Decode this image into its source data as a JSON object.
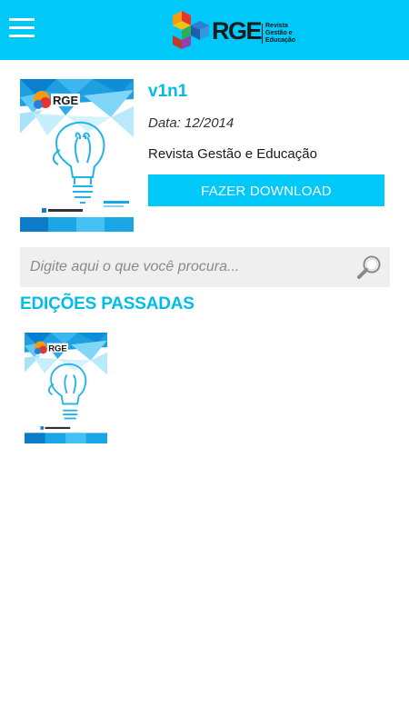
{
  "header": {
    "logo_text": "RGE",
    "logo_subtitle": "Revista Gestão e Educação",
    "background_color": "#00c8f8"
  },
  "current_issue": {
    "title": "v1n1",
    "date": "Data: 12/2014",
    "journal": "Revista Gestão e Educação",
    "download_label": "FAZER DOWNLOAD",
    "cover_image": "magazine-cover-lightbulb"
  },
  "search": {
    "placeholder": "Digite aqui o que você procura...",
    "value": "",
    "icon": "magnifier-icon"
  },
  "past_editions": {
    "title": "EDIÇÕES PASSADAS",
    "items": [
      {
        "cover_image": "magazine-cover-lightbulb"
      }
    ]
  },
  "colors": {
    "accent": "#00c8f8",
    "heading": "#00bde8",
    "search_bg": "#efefef"
  }
}
